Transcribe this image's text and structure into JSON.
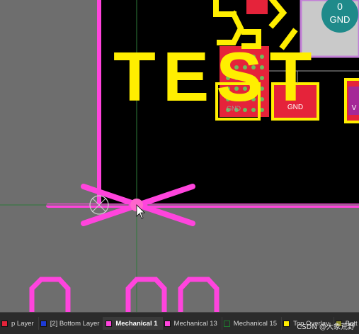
{
  "pcb": {
    "silkscreen_text": "TEST",
    "pad_net_label_1": "GND",
    "pad_net_label_2": "GND",
    "pad_net_label_3": "V",
    "pad_top_number": "0",
    "pad_top_net": "GND",
    "colors": {
      "board": "#000000",
      "outside": "#6e6e6e",
      "mechanical": "#ff44dd",
      "silkscreen": "#ffee00",
      "pad": "#e5233a",
      "via": "#2a8f8a",
      "grid_line": "#1f6a2f"
    }
  },
  "layer_tabs": [
    {
      "label": "p Layer",
      "color": "#e5233a"
    },
    {
      "label": "[2] Bottom Layer",
      "color": "#1d3bd6"
    },
    {
      "label": "Mechanical 1",
      "color": "#ff44dd",
      "active": true
    },
    {
      "label": "Mechanical 13",
      "color": "#ff44dd"
    },
    {
      "label": "Mechanical 15",
      "color": "#1e7b2e"
    },
    {
      "label": "Top Overlay",
      "color": "#ffee00"
    },
    {
      "label": "Bott",
      "color": "#8c8c2a"
    }
  ],
  "watermark": "CSDN @大象荒野"
}
